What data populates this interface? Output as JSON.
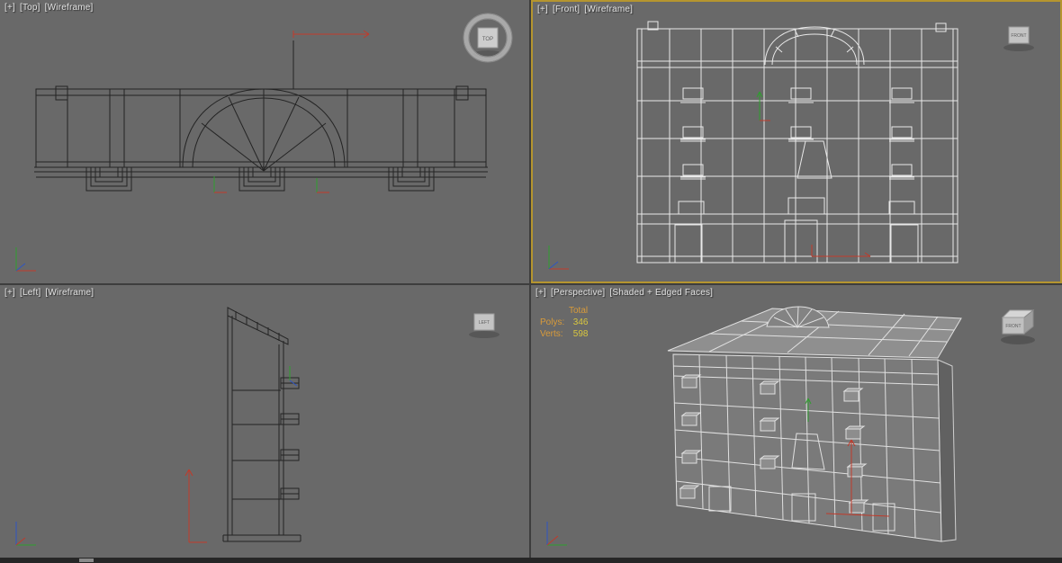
{
  "colors": {
    "viewport_bg": "#696969",
    "page_bg": "#3d3d3d",
    "active_border": "#b5952f",
    "wire_dark": "#242424",
    "wire_light": "#e9e9e9",
    "axis_x": "#c23a2a",
    "axis_y": "#2f9e2f",
    "axis_z": "#2f55c2",
    "stats_label": "#d99b3a",
    "stats_value": "#d8c63f"
  },
  "viewports": {
    "top": {
      "menu": "[+]",
      "view": "[Top]",
      "shading": "[Wireframe]",
      "cube": "TOP"
    },
    "front": {
      "menu": "[+]",
      "view": "[Front]",
      "shading": "[Wireframe]",
      "cube": "FRONT"
    },
    "left": {
      "menu": "[+]",
      "view": "[Left]",
      "shading": "[Wireframe]",
      "cube": "LEFT"
    },
    "perspective": {
      "menu": "[+]",
      "view": "[Perspective]",
      "shading": "[Shaded + Edged Faces]",
      "cube": "FRONT"
    }
  },
  "stats": {
    "header": "Total",
    "rows": [
      {
        "label": "Polys:",
        "value": "346"
      },
      {
        "label": "Verts:",
        "value": "598"
      }
    ]
  }
}
